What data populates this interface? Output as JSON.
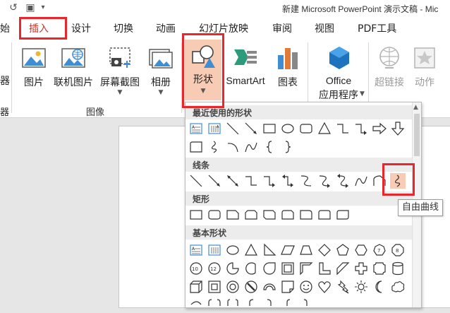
{
  "window": {
    "title": "新建 Microsoft PowerPoint 演示文稿 - Mic"
  },
  "tabs": [
    {
      "label": "始"
    },
    {
      "label": "插入"
    },
    {
      "label": "设计"
    },
    {
      "label": "切换"
    },
    {
      "label": "动画"
    },
    {
      "label": "幻灯片放映"
    },
    {
      "label": "审阅"
    },
    {
      "label": "视图"
    },
    {
      "label": "PDF工具"
    }
  ],
  "ribbon": {
    "left_edge": {
      "label_top": "器",
      "label_bottom": "器"
    },
    "images_group": {
      "label": "图像",
      "picture": "图片",
      "online_picture": "联机图片",
      "screenshot": "屏幕截图",
      "album": "相册"
    },
    "shapes_button": "形状",
    "smartart": "SmartArt",
    "chart": "图表",
    "office_apps_line1": "Office",
    "office_apps_line2": "应用程序",
    "hyperlink": "超链接",
    "action": "动作"
  },
  "shapes_panel": {
    "recent_header": "最近使用的形状",
    "lines_header": "线条",
    "rect_header": "矩形",
    "basic_header": "基本形状"
  },
  "tooltip": {
    "text": "自由曲线"
  },
  "colors": {
    "accent_red": "#e8262b",
    "active_tab": "#c8352b",
    "selected_bg": "#f8cbb4"
  }
}
